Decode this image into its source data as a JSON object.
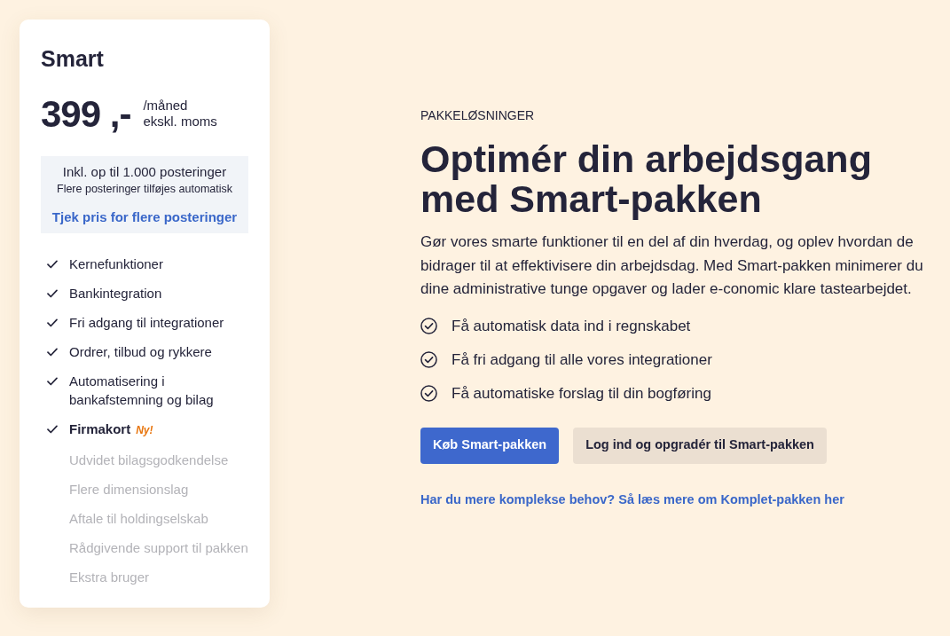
{
  "plan_card": {
    "name": "Smart",
    "price": "399 ,-",
    "price_note": [
      "/måned",
      "ekskl. moms"
    ],
    "entries_box": {
      "included": "Inkl. op til 1.000 posteringer",
      "note": "Flere posteringer tilføjes automatisk",
      "link": "Tjek pris for flere posteringer"
    },
    "features": [
      {
        "label": "Kernefunktioner",
        "included": true,
        "emphasized": false
      },
      {
        "label": "Bankintegration",
        "included": true,
        "emphasized": false
      },
      {
        "label": "Fri adgang til integrationer",
        "included": true,
        "emphasized": false
      },
      {
        "label": "Ordrer, tilbud og rykkere",
        "included": true,
        "emphasized": false
      },
      {
        "label": "Automatisering i bankafstemning og bilag",
        "included": true,
        "emphasized": false
      },
      {
        "label": "Firmakort",
        "included": true,
        "emphasized": true,
        "badge": "Ny!"
      },
      {
        "label": "Udvidet bilagsgodkendelse",
        "included": false,
        "emphasized": false
      },
      {
        "label": "Flere dimensionslag",
        "included": false,
        "emphasized": false
      },
      {
        "label": "Aftale til holdingselskab",
        "included": false,
        "emphasized": false
      },
      {
        "label": "Rådgivende support til pakken",
        "included": false,
        "emphasized": false
      },
      {
        "label": "Ekstra bruger",
        "included": false,
        "emphasized": false
      }
    ]
  },
  "hero": {
    "eyebrow": "PAKKELØSNINGER",
    "title": "Optimér din arbejdsgang med Smart-pakken",
    "description": "Gør vores smarte funktioner til en del af din hverdag, og oplev hvordan de bidrager til at effektivisere din arbejdsdag. Med Smart-pakken minimerer du dine administrative tunge opgaver og lader e-conomic klare tastearbejdet.",
    "benefits": [
      "Få automatisk data ind i regnskabet",
      "Få fri adgang til alle vores integrationer",
      "Få automatiske forslag til din bogføring"
    ],
    "buttons": [
      {
        "label": "Køb Smart-pakken",
        "kind": "primary"
      },
      {
        "label": "Log ind og opgradér til Smart-pakken",
        "kind": "secondary"
      }
    ],
    "link": "Har du mere komplekse behov? Så læs mere om Komplet-pakken her"
  }
}
